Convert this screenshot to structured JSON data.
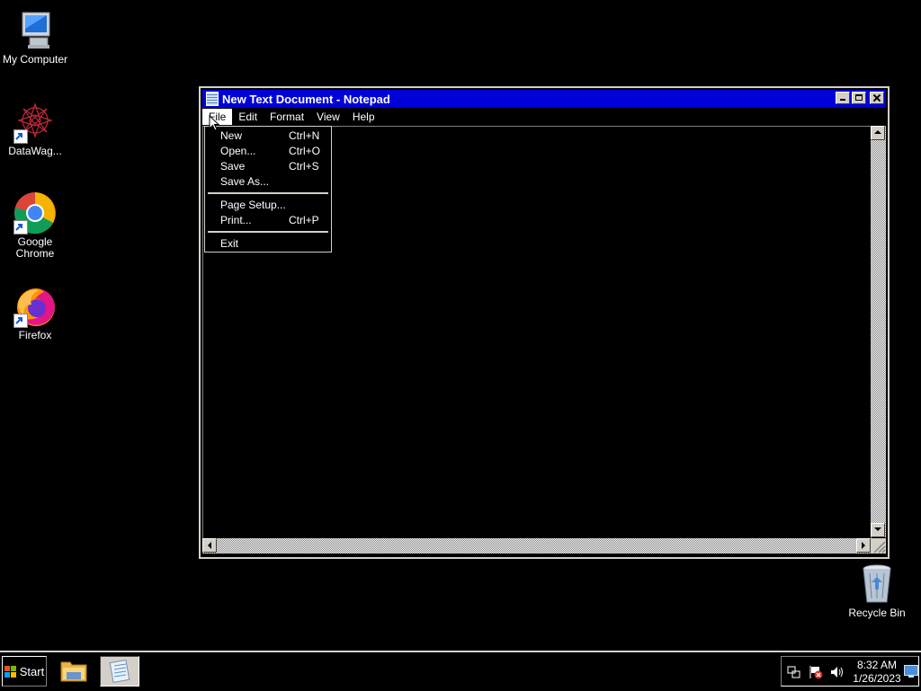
{
  "desktop": {
    "icons": [
      {
        "label": "My Computer"
      },
      {
        "label": "DataWag..."
      },
      {
        "label": "Google Chrome"
      },
      {
        "label": "Firefox"
      },
      {
        "label": "Recycle Bin"
      }
    ]
  },
  "window": {
    "title": "New Text Document - Notepad",
    "menu": [
      "File",
      "Edit",
      "Format",
      "View",
      "Help"
    ]
  },
  "file_menu": {
    "items": [
      {
        "label": "New",
        "shortcut": "Ctrl+N"
      },
      {
        "label": "Open...",
        "shortcut": "Ctrl+O"
      },
      {
        "label": "Save",
        "shortcut": "Ctrl+S"
      },
      {
        "label": "Save As...",
        "shortcut": ""
      },
      {
        "label": "Page Setup...",
        "shortcut": ""
      },
      {
        "label": "Print...",
        "shortcut": "Ctrl+P"
      },
      {
        "label": "Exit",
        "shortcut": ""
      }
    ]
  },
  "taskbar": {
    "start_label": "Start",
    "time": "8:32 AM",
    "date": "1/26/2023"
  },
  "colors": {
    "titlebar": "#0000d8",
    "desktop": "#000000",
    "chrome": "#d4d0c8"
  }
}
